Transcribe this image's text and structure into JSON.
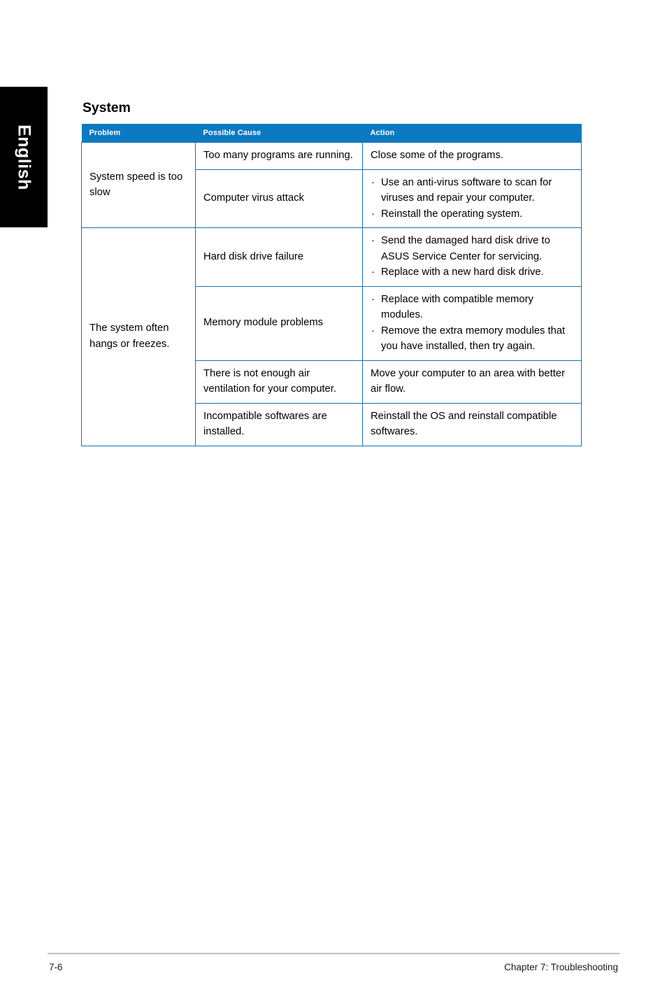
{
  "language_tab": {
    "label": "English"
  },
  "page": {
    "heading": "System"
  },
  "table": {
    "headers": [
      "Problem",
      "Possible Cause",
      "Action"
    ],
    "rows": [
      {
        "problem": "System speed is too slow",
        "causes": [
          {
            "cause": "Too many programs are running.",
            "action_type": "text",
            "action_text": "Close some of the programs.",
            "action_items": []
          },
          {
            "cause": "Computer virus attack",
            "action_type": "bullets",
            "action_text": "",
            "action_items": [
              "Use an anti-virus software to scan for viruses and repair your computer.",
              "Reinstall the operating system."
            ]
          }
        ]
      },
      {
        "problem": "The system often hangs or freezes.",
        "causes": [
          {
            "cause": "Hard disk drive failure",
            "action_type": "bullets",
            "action_text": "",
            "action_items": [
              "Send the damaged hard disk drive to ASUS Service Center for servicing.",
              "Replace with a new hard disk drive."
            ]
          },
          {
            "cause": "Memory module problems",
            "action_type": "bullets",
            "action_text": "",
            "action_items": [
              "Replace with compatible memory modules.",
              "Remove the extra memory modules that you have installed, then try again."
            ]
          },
          {
            "cause": "There is not enough air ventilation for your computer.",
            "action_type": "text",
            "action_text": "Move your computer to an area with better air flow.",
            "action_items": []
          },
          {
            "cause": "Incompatible softwares are installed.",
            "action_type": "text",
            "action_text": "Reinstall the OS and reinstall compatible softwares.",
            "action_items": []
          }
        ]
      }
    ]
  },
  "footer": {
    "page_number": "7-6",
    "chapter": "Chapter 7: Troubleshooting"
  },
  "colors": {
    "header_blue": "#0c7ac0",
    "border_blue": "#1172b4",
    "tab_black": "#000000",
    "rule_gray": "#bfbfbf"
  },
  "bullet_glyph": "·"
}
